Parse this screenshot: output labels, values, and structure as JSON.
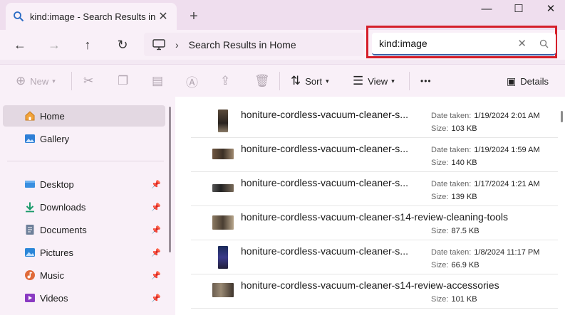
{
  "window": {
    "tab_title": "kind:image - Search Results in",
    "tab_close": "✕",
    "new_tab": "+",
    "minimize": "—",
    "maximize": "☐",
    "close": "✕"
  },
  "nav": {
    "back": "←",
    "forward": "→",
    "up": "↑",
    "refresh": "↻",
    "separator": "›",
    "breadcrumb": "Search Results in Home"
  },
  "search": {
    "value": "kind:image",
    "clear": "✕"
  },
  "toolbar": {
    "new_label": "New",
    "sort_label": "Sort",
    "view_label": "View",
    "more_label": "•••",
    "details_label": "Details"
  },
  "sidebar": {
    "items": [
      {
        "label": "Home"
      },
      {
        "label": "Gallery"
      },
      {
        "label": "Desktop"
      },
      {
        "label": "Downloads"
      },
      {
        "label": "Documents"
      },
      {
        "label": "Pictures"
      },
      {
        "label": "Music"
      },
      {
        "label": "Videos"
      }
    ]
  },
  "files": [
    {
      "name": "honiture-cordless-vacuum-cleaner-s...",
      "date_label": "Date taken:",
      "date": "1/19/2024 2:01 AM",
      "size_label": "Size:",
      "size": "103 KB"
    },
    {
      "name": "honiture-cordless-vacuum-cleaner-s...",
      "date_label": "Date taken:",
      "date": "1/19/2024 1:59 AM",
      "size_label": "Size:",
      "size": "140 KB"
    },
    {
      "name": "honiture-cordless-vacuum-cleaner-s...",
      "date_label": "Date taken:",
      "date": "1/17/2024 1:21 AM",
      "size_label": "Size:",
      "size": "139 KB"
    },
    {
      "name": "honiture-cordless-vacuum-cleaner-s14-review-cleaning-tools",
      "size_label": "Size:",
      "size": "87.5 KB"
    },
    {
      "name": "honiture-cordless-vacuum-cleaner-s...",
      "date_label": "Date taken:",
      "date": "1/8/2024 11:17 PM",
      "size_label": "Size:",
      "size": "66.9 KB"
    },
    {
      "name": "honiture-cordless-vacuum-cleaner-s14-review-accessories",
      "size_label": "Size:",
      "size": "101 KB"
    }
  ],
  "colors": {
    "highlight_box": "#d51f2a",
    "search_underline": "#3b5fa5",
    "chrome_bg": "#f9f0f8"
  }
}
